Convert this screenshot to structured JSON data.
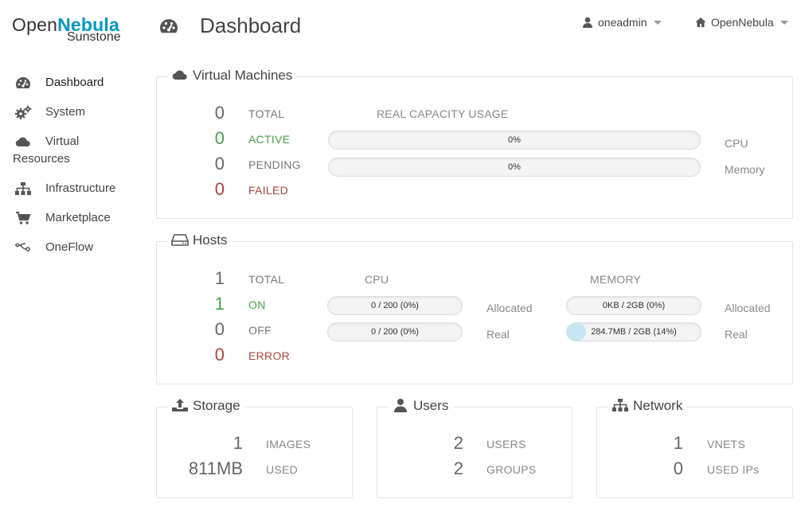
{
  "logo": {
    "part1": "Open",
    "part2": "Nebula",
    "sub": "Sunstone"
  },
  "sidebar": {
    "items": [
      {
        "label": "Dashboard",
        "icon": "dashboard-icon"
      },
      {
        "label": "System",
        "icon": "gears-icon"
      },
      {
        "label": "Virtual",
        "label2": "Resources",
        "icon": "cloud-icon"
      },
      {
        "label": "Infrastructure",
        "icon": "sitemap-icon"
      },
      {
        "label": "Marketplace",
        "icon": "cart-icon"
      },
      {
        "label": "OneFlow",
        "icon": "flow-icon"
      }
    ]
  },
  "header": {
    "title": "Dashboard",
    "user": "oneadmin",
    "zone": "OpenNebula"
  },
  "vms": {
    "title": "Virtual Machines",
    "capacity_header": "REAL CAPACITY USAGE",
    "stats": [
      {
        "value": "0",
        "label": "TOTAL"
      },
      {
        "value": "0",
        "label": "ACTIVE"
      },
      {
        "value": "0",
        "label": "PENDING"
      },
      {
        "value": "0",
        "label": "FAILED"
      }
    ],
    "cpu_bar": {
      "text": "0%",
      "percent": 0,
      "label": "CPU"
    },
    "mem_bar": {
      "text": "0%",
      "percent": 0,
      "label": "Memory"
    }
  },
  "hosts": {
    "title": "Hosts",
    "cpu_header": "CPU",
    "memory_header": "MEMORY",
    "stats": [
      {
        "value": "1",
        "label": "TOTAL"
      },
      {
        "value": "1",
        "label": "ON"
      },
      {
        "value": "0",
        "label": "OFF"
      },
      {
        "value": "0",
        "label": "ERROR"
      }
    ],
    "cpu_allocated": {
      "text": "0 / 200 (0%)",
      "percent": 0
    },
    "cpu_real": {
      "text": "0 / 200 (0%)",
      "percent": 0
    },
    "mem_allocated": {
      "text": "0KB / 2GB (0%)",
      "percent": 0
    },
    "mem_real": {
      "text": "284.7MB / 2GB (14%)",
      "percent": 14
    },
    "allocated_label": "Allocated",
    "real_label": "Real"
  },
  "storage": {
    "title": "Storage",
    "rows": [
      {
        "value": "1",
        "label": "IMAGES"
      },
      {
        "value": "811MB",
        "label": "USED"
      }
    ]
  },
  "users": {
    "title": "Users",
    "rows": [
      {
        "value": "2",
        "label": "USERS"
      },
      {
        "value": "2",
        "label": "GROUPS"
      }
    ]
  },
  "network": {
    "title": "Network",
    "rows": [
      {
        "value": "1",
        "label": "VNETS"
      },
      {
        "value": "0",
        "label": "USED IPs"
      }
    ]
  },
  "colors": {
    "brand": "#0098c3",
    "active": "#4a9e4a",
    "failed": "#a94442",
    "bar_fill": "#c7e4f2"
  }
}
